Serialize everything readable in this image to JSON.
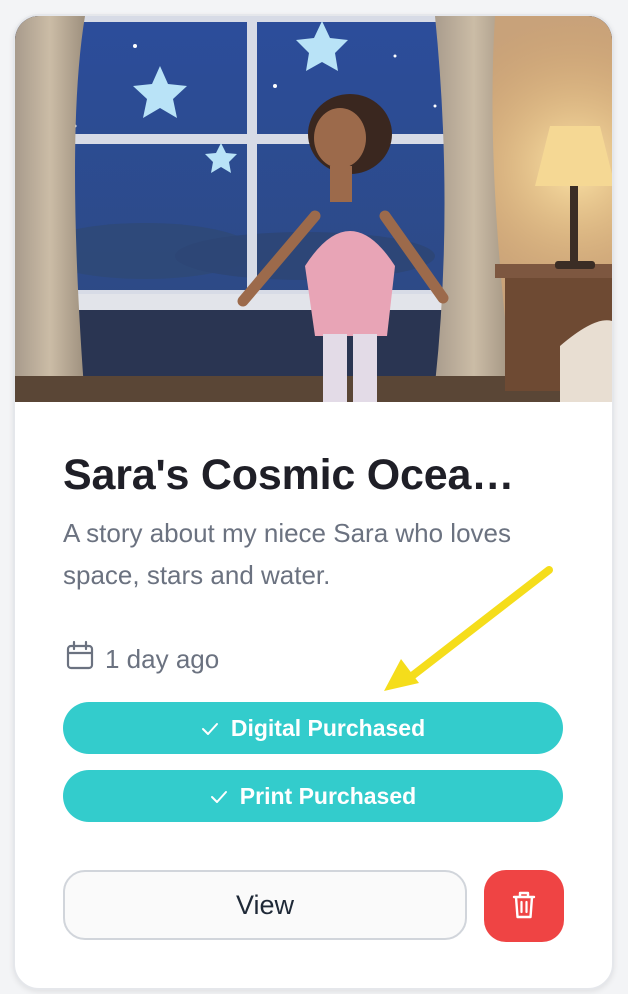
{
  "story_card": {
    "title": "Sara's Cosmic Ocea…",
    "description": "A story about my niece Sara who loves space, stars and water.",
    "created_ago": "1 day ago",
    "icons": {
      "date": "calendar-icon",
      "check": "check-icon",
      "delete": "trash-icon"
    },
    "badges": {
      "digital_label": "Digital Purchased",
      "print_label": "Print Purchased"
    },
    "actions": {
      "view_label": "View"
    },
    "colors": {
      "badge": "#33cccc",
      "delete": "#ef4444",
      "annotation_arrow": "#f5dd1b"
    }
  }
}
